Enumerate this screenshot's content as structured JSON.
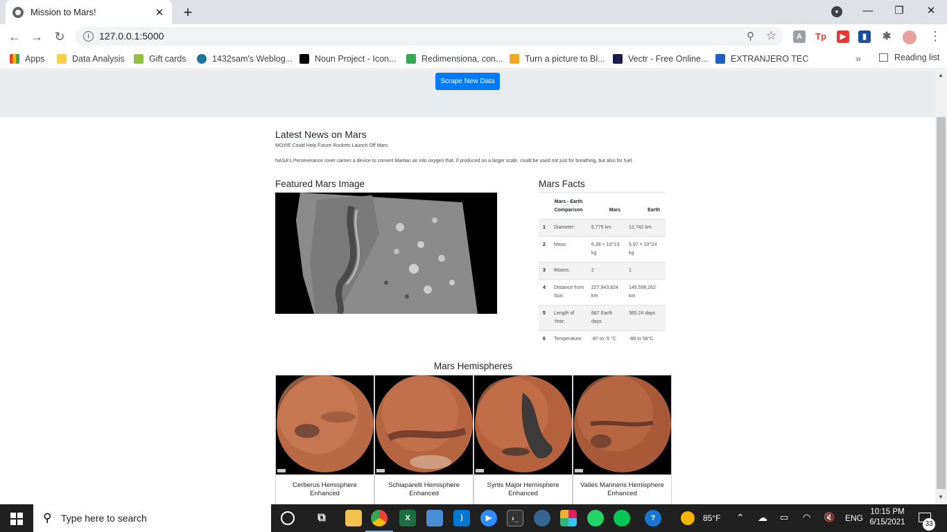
{
  "browser": {
    "tab_title": "Mission to Mars!",
    "url": "127.0.0.1:5000",
    "bookmarks": [
      {
        "label": "Apps",
        "icon": "apps-grid-icon",
        "color": "#ea4335"
      },
      {
        "label": "Data Analysis",
        "icon": "folder-icon",
        "color": "#f9cf4a"
      },
      {
        "label": "Gift cards",
        "icon": "shopify-icon",
        "color": "#95bf47"
      },
      {
        "label": "1432sam's Weblog...",
        "icon": "wordpress-icon",
        "color": "#21759b"
      },
      {
        "label": "Noun Project - Icon...",
        "icon": "noun-project-icon",
        "color": "#000000"
      },
      {
        "label": "Redimensiona, con...",
        "icon": "resize-icon",
        "color": "#34a853"
      },
      {
        "label": "Turn a picture to Bl...",
        "icon": "picture-icon",
        "color": "#f5a623"
      },
      {
        "label": "Vectr - Free Online...",
        "icon": "vectr-icon",
        "color": "#1a1a4e"
      },
      {
        "label": "EXTRANJERO TEC",
        "icon": "gear-blue-icon",
        "color": "#1f5fbf"
      }
    ],
    "more_bookmarks": "»",
    "reading_list": "Reading list"
  },
  "page": {
    "scrape_button": "Scrape New Data",
    "news": {
      "heading": "Latest News on Mars",
      "headline": "MOXIE Could Help Future Rockets Launch Off Mars",
      "body": "NASA's Perseverance rover carries a device to convert Martian air into oxygen that, if produced on a larger scale, could be used not just for breathing, but also for fuel."
    },
    "featured": {
      "heading": "Featured Mars Image"
    },
    "facts": {
      "heading": "Mars Facts",
      "columns": [
        "Mars - Earth Comparison",
        "Mars",
        "Earth"
      ],
      "rows": [
        {
          "idx": "1",
          "label": "Diameter:",
          "mars": "6,779 km",
          "earth": "12,742 km"
        },
        {
          "idx": "2",
          "label": "Mass:",
          "mars": "6.39 × 10^23 kg",
          "earth": "5.97 × 10^24 kg"
        },
        {
          "idx": "3",
          "label": "Moons:",
          "mars": "2",
          "earth": "1"
        },
        {
          "idx": "4",
          "label": "Distance from Sun:",
          "mars": "227,943,824 km",
          "earth": "149,598,262 km"
        },
        {
          "idx": "5",
          "label": "Length of Year:",
          "mars": "687 Earth days",
          "earth": "365.24 days"
        },
        {
          "idx": "6",
          "label": "Temperature:",
          "mars": "-87 to -5 °C",
          "earth": "-88 to 58°C"
        }
      ]
    },
    "hemispheres": {
      "heading": "Mars Hemispheres",
      "items": [
        {
          "title": "Cerberus Hemisphere Enhanced"
        },
        {
          "title": "Schiaparelli Hemisphere Enhanced"
        },
        {
          "title": "Syrtis Major Hemisphere Enhanced"
        },
        {
          "title": "Valles Marineris Hemisphere Enhanced"
        }
      ]
    }
  },
  "taskbar": {
    "search_placeholder": "Type here to search",
    "weather": "85°F",
    "language": "ENG",
    "time": "10:15 PM",
    "date": "6/15/2021",
    "notifications": "33"
  }
}
